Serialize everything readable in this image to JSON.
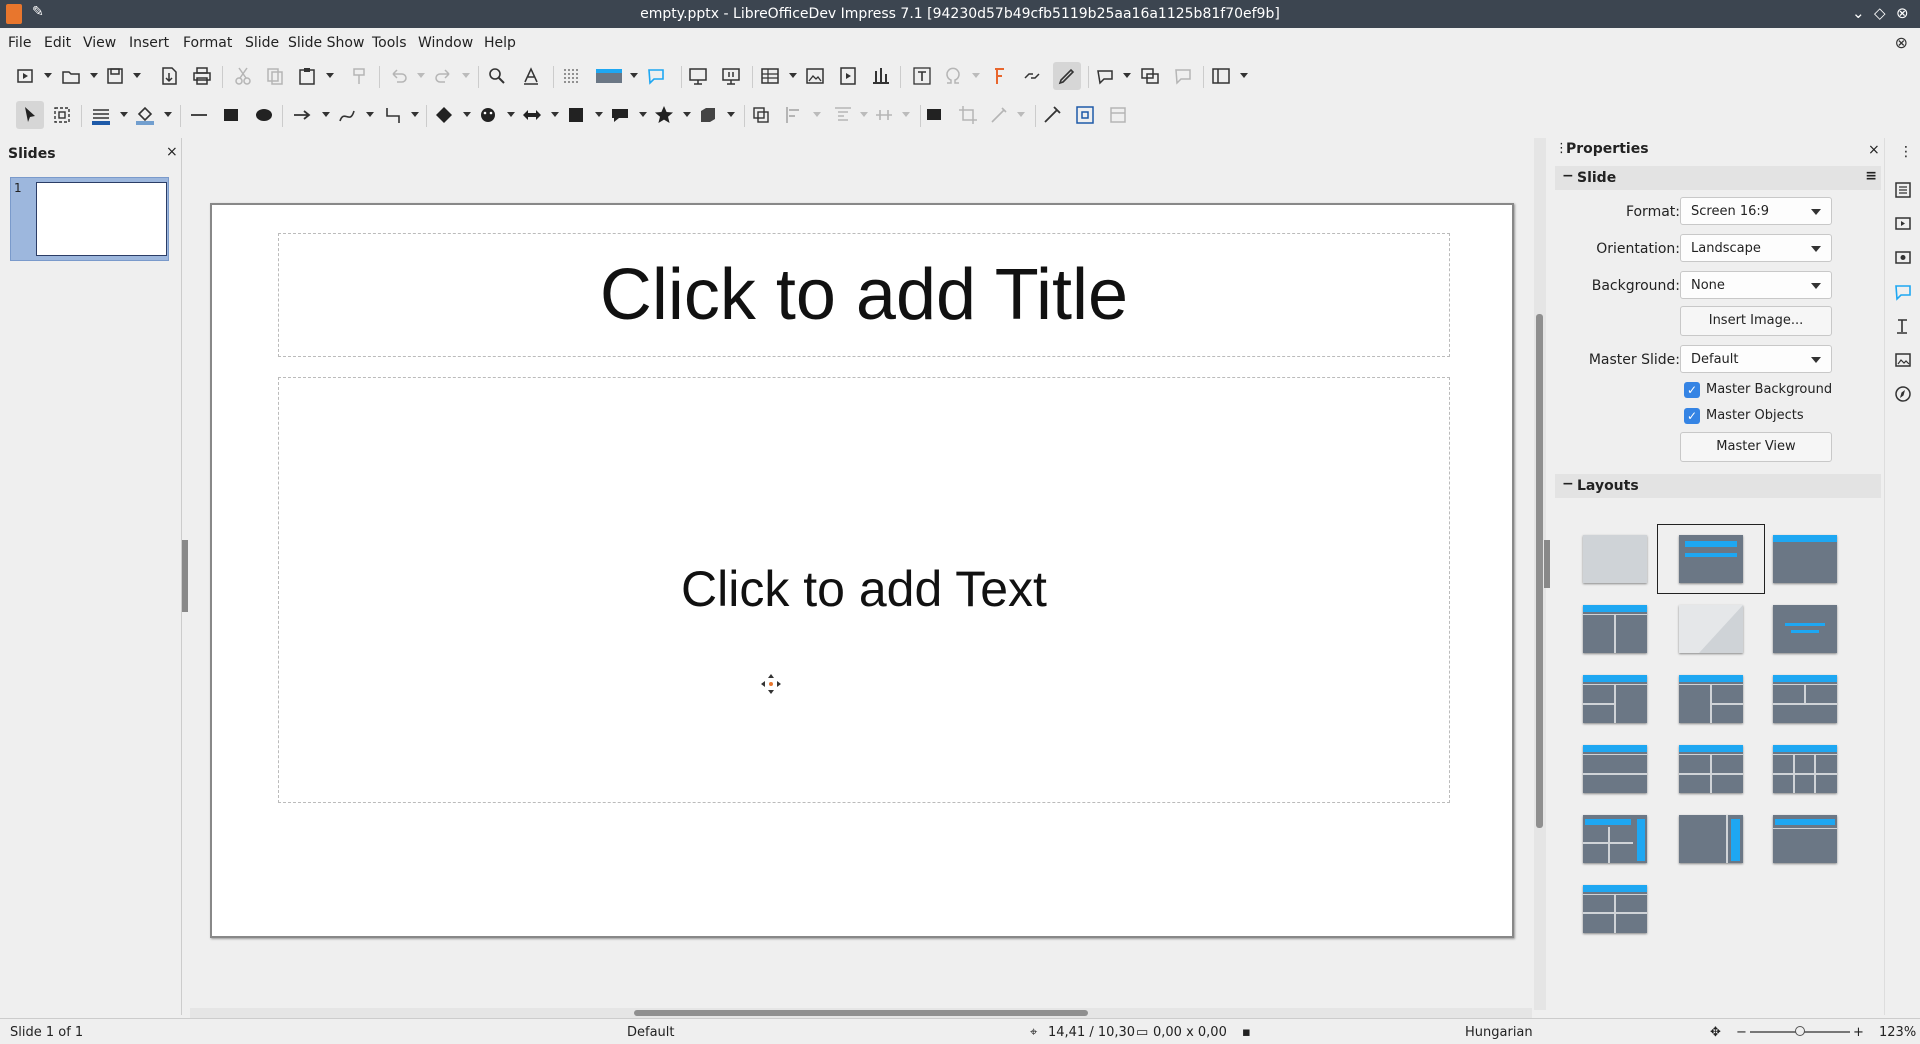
{
  "window": {
    "title": "empty.pptx - LibreOfficeDev Impress 7.1 [94230d57b49cfb5119b25aa16a1125b81f70ef9b]"
  },
  "menu": [
    "File",
    "Edit",
    "View",
    "Insert",
    "Format",
    "Slide",
    "Slide Show",
    "Tools",
    "Window",
    "Help"
  ],
  "slides_panel": {
    "title": "Slides",
    "close": "×",
    "slide_number": "1"
  },
  "slide": {
    "title_placeholder": "Click to add Title",
    "text_placeholder": "Click to add Text"
  },
  "properties": {
    "title": "Properties",
    "close": "×",
    "slide_section": {
      "title": "Slide",
      "format_label": "Format:",
      "format_value": "Screen 16:9",
      "orientation_label": "Orientation:",
      "orientation_value": "Landscape",
      "background_label": "Background:",
      "background_value": "None",
      "insert_image": "Insert Image...",
      "master_slide_label": "Master Slide:",
      "master_slide_value": "Default",
      "master_background": "Master Background",
      "master_objects": "Master Objects",
      "master_view": "Master View"
    },
    "layouts_section": {
      "title": "Layouts"
    }
  },
  "status": {
    "slide_info": "Slide 1 of 1",
    "master": "Default",
    "position": "14,41 / 10,30",
    "size": "0,00 x 0,00",
    "language": "Hungarian",
    "zoom_minus": "−",
    "zoom_plus": "+",
    "zoom": "123%"
  },
  "colors": {
    "accent": "#3584e4",
    "layout_blue": "#1ea7f2",
    "layout_gray": "#6b7785"
  },
  "icons": [
    "new-slide-icon",
    "open-icon",
    "save-icon",
    "export-pdf-icon",
    "print-icon",
    "cut-icon",
    "copy-icon",
    "paste-icon",
    "clone-formatting-icon",
    "undo-icon",
    "redo-icon",
    "find-replace-icon",
    "spelling-icon",
    "grid-icon",
    "display-views-icon",
    "master-slide-icon",
    "start-first-slide-icon",
    "start-current-slide-icon",
    "table-icon",
    "image-icon",
    "media-icon",
    "chart-icon",
    "textbox-icon",
    "special-character-icon",
    "fontwork-icon",
    "hyperlink-icon",
    "draw-function-icon",
    "shapes-icon",
    "show-draw-icon",
    "comments-icon",
    "display-mode-icon"
  ]
}
